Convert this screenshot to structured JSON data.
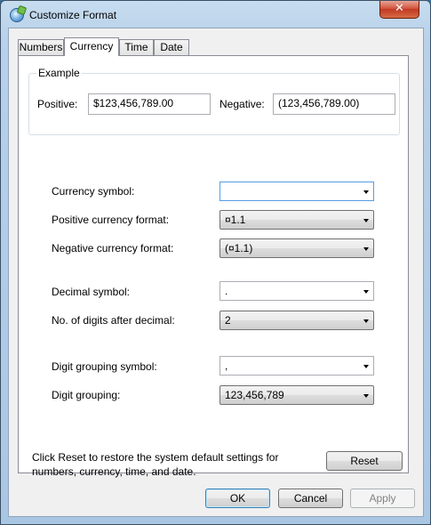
{
  "window": {
    "title": "Customize Format",
    "close_glyph": "✕"
  },
  "tabs": [
    {
      "label": "Numbers"
    },
    {
      "label": "Currency",
      "active": true
    },
    {
      "label": "Time"
    },
    {
      "label": "Date"
    }
  ],
  "example": {
    "legend": "Example",
    "positive_label": "Positive:",
    "positive_value": "$123,456,789.00",
    "negative_label": "Negative:",
    "negative_value": "(123,456,789.00)"
  },
  "fields": {
    "currency_symbol": {
      "label": "Currency symbol:",
      "value": ""
    },
    "positive_format": {
      "label": "Positive currency format:",
      "value": "¤1.1"
    },
    "negative_format": {
      "label": "Negative currency format:",
      "value": "(¤1.1)"
    },
    "decimal_symbol": {
      "label": "Decimal symbol:",
      "value": "."
    },
    "digits_after_decimal": {
      "label": "No. of digits after decimal:",
      "value": "2"
    },
    "digit_grouping_symbol": {
      "label": "Digit grouping symbol:",
      "value": ","
    },
    "digit_grouping": {
      "label": "Digit grouping:",
      "value": "123,456,789"
    }
  },
  "footer": {
    "reset_note": "Click Reset to restore the system default settings for numbers, currency, time, and date.",
    "reset_label": "Reset",
    "ok_label": "OK",
    "cancel_label": "Cancel",
    "apply_label": "Apply"
  }
}
